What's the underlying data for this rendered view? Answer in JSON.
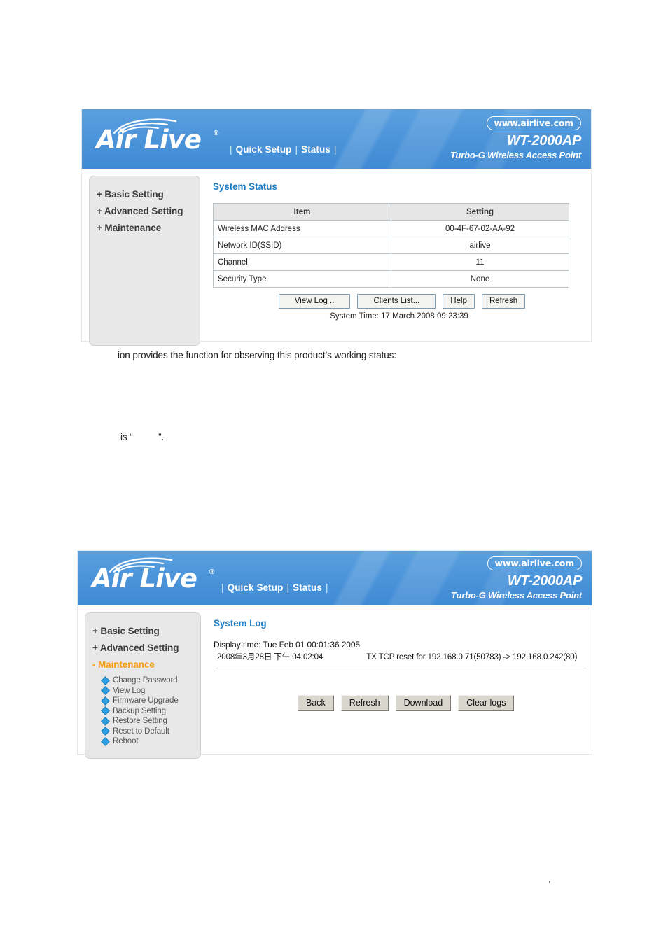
{
  "branding": {
    "name": "Air Live",
    "registered_mark": "®",
    "url_pill": "www.airlive.com",
    "model": "WT-2000AP",
    "model_desc": "Turbo-G Wireless Access Point",
    "nav": {
      "separator_left": "|",
      "quick_setup": "Quick Setup",
      "separator_mid": "|",
      "status": "Status",
      "separator_right": "|"
    },
    "header_blue": "#4a93d9",
    "accent_orange": "#f59b14",
    "title_blue": "#1f7ec4"
  },
  "status_panel": {
    "sidebar": {
      "items": [
        {
          "label": "+ Basic Setting",
          "active": false
        },
        {
          "label": "+ Advanced Setting",
          "active": false
        },
        {
          "label": "+ Maintenance",
          "active": false
        }
      ]
    },
    "section_title": "System Status",
    "table": {
      "headers": [
        "Item",
        "Setting"
      ],
      "rows": [
        {
          "item": "Wireless MAC Address",
          "value": "00-4F-67-02-AA-92"
        },
        {
          "item": "Network ID(SSID)",
          "value": "airlive"
        },
        {
          "item": "Channel",
          "value": "11"
        },
        {
          "item": "Security Type",
          "value": "None"
        }
      ]
    },
    "buttons": [
      {
        "label": "View Log .."
      },
      {
        "label": "Clients List..."
      },
      {
        "label": "Help"
      },
      {
        "label": "Refresh"
      }
    ],
    "system_time": "System Time: 17 March 2008 09:23:39"
  },
  "log_panel": {
    "sidebar": {
      "items": [
        {
          "label": "+ Basic Setting",
          "active": false
        },
        {
          "label": "+ Advanced Setting",
          "active": false
        },
        {
          "label": "- Maintenance",
          "active": true
        }
      ],
      "sub_items": [
        {
          "label": "Change Password"
        },
        {
          "label": "View Log"
        },
        {
          "label": "Firmware Upgrade"
        },
        {
          "label": "Backup Setting"
        },
        {
          "label": "Restore Setting"
        },
        {
          "label": "Reset to Default"
        },
        {
          "label": "Reboot"
        }
      ]
    },
    "section_title": "System Log",
    "display_time": "Display time: Tue Feb 01 00:01:36 2005",
    "entry": {
      "timestamp": "2008年3月28日 下午 04:02:04",
      "message": "TX TCP reset for 192.168.0.71(50783) -> 192.168.0.242(80)"
    },
    "buttons": [
      {
        "label": "Back"
      },
      {
        "label": "Refresh"
      },
      {
        "label": "Download"
      },
      {
        "label": "Clear logs"
      }
    ]
  },
  "document": {
    "paragraph_1": "ion provides the function for observing this product’s working status:",
    "paragraph_2": "is “          ”.",
    "page_mark": ","
  }
}
